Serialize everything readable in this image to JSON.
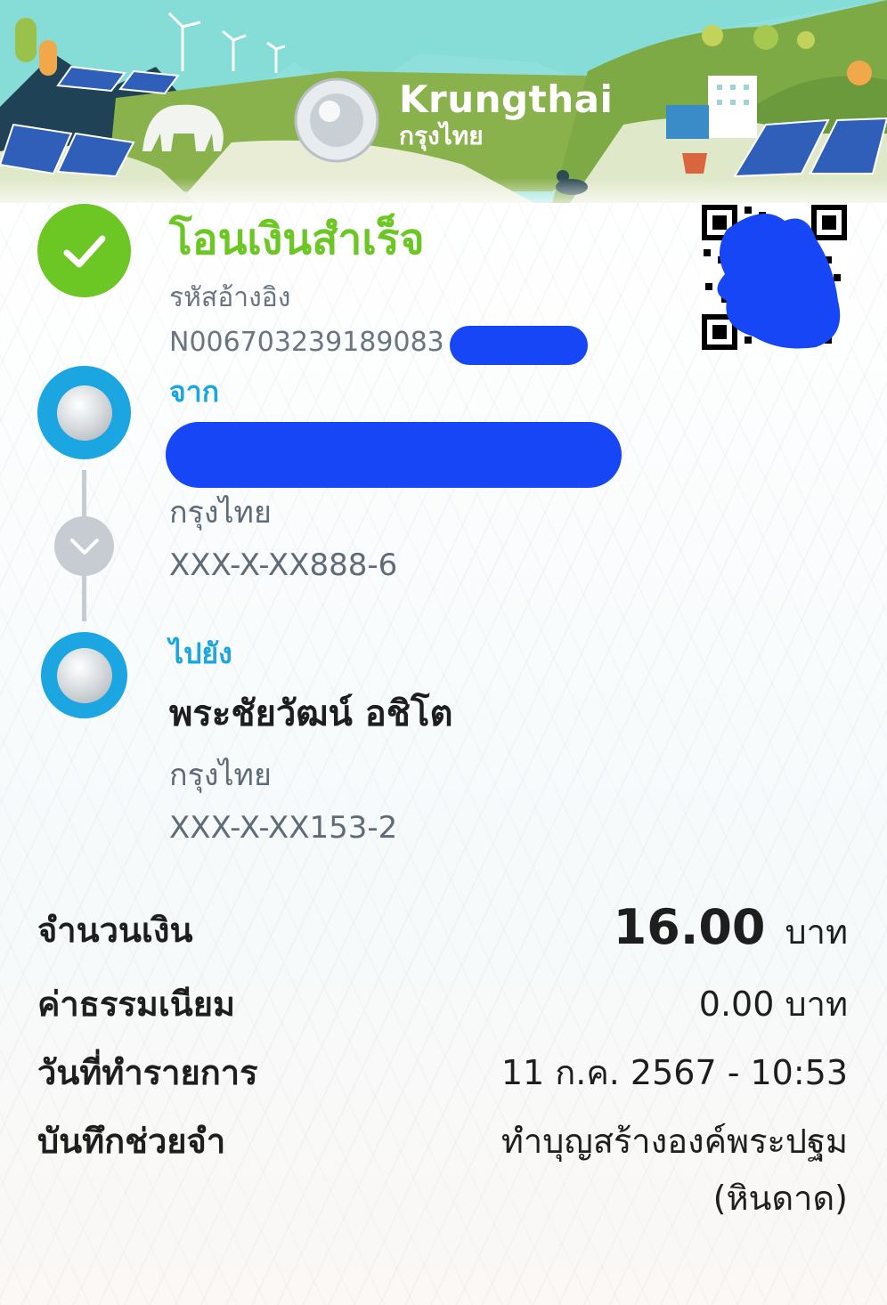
{
  "banner": {
    "brand_en": "Krungthai",
    "brand_th": "กรุงไทย"
  },
  "status": {
    "title": "โอนเงินสำเร็จ",
    "ref_label": "รหัสอ้างอิง",
    "ref_value": "N006703239189083",
    "icon": "check-icon"
  },
  "from": {
    "label": "จาก",
    "bank": "กรุงไทย",
    "account": "XXX-X-XX888-6"
  },
  "to": {
    "label": "ไปยัง",
    "name": "พระชัยวัฒน์ อชิโต",
    "bank": "กรุงไทย",
    "account": "XXX-X-XX153-2"
  },
  "details": {
    "amount_label": "จำนวนเงิน",
    "amount_value": "16.00",
    "amount_unit": "บาท",
    "fee_label": "ค่าธรรมเนียม",
    "fee_value": "0.00 บาท",
    "date_label": "วันที่ทำรายการ",
    "date_value": "11 ก.ค. 2567 - 10:53",
    "memo_label": "บันทึกช่วยจำ",
    "memo_line1": "ทำบุญสร้างองค์พระปฐม",
    "memo_line2": "(หินดาด)"
  },
  "colors": {
    "success": "#6cc623",
    "brand": "#1ba5e1",
    "redaction": "#1646f5"
  }
}
